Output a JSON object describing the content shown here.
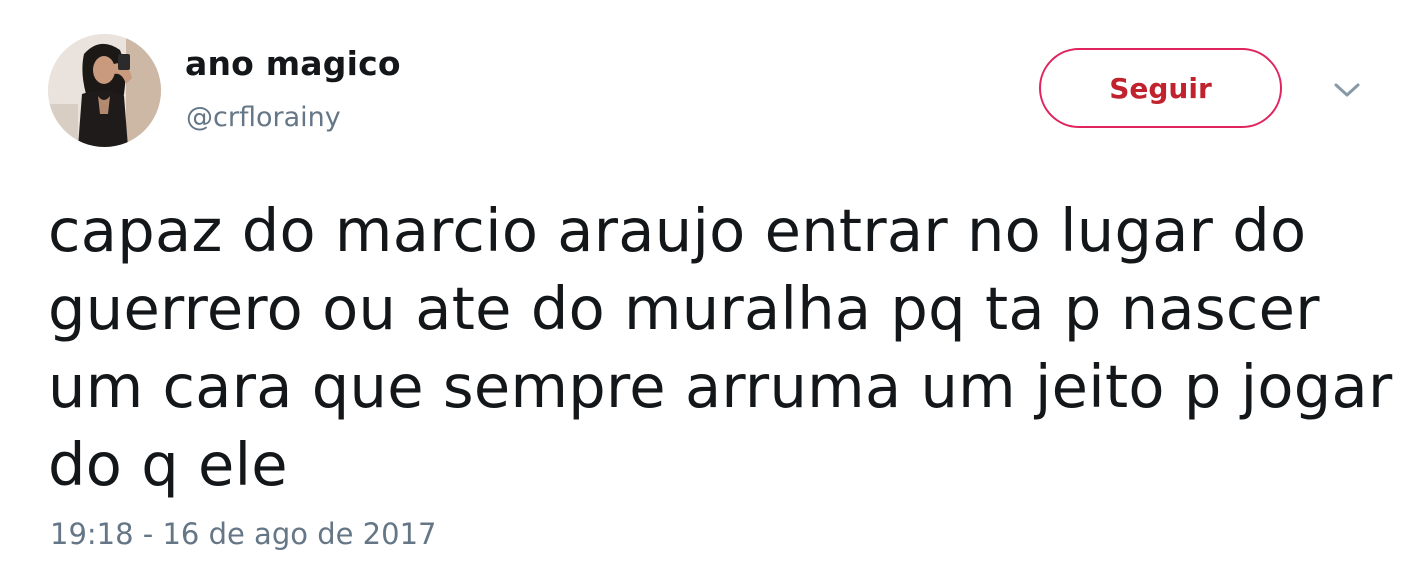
{
  "tweet": {
    "author": {
      "display_name": "ano magico",
      "handle": "@crflorainy"
    },
    "follow_button_label": "Seguir",
    "text_lines": [
      "capaz do marcio araujo entrar no lugar do",
      "guerrero ou ate do muralha pq ta p nascer",
      "um cara que sempre arruma um jeito p jogar",
      "do q ele"
    ],
    "timestamp": "19:18 - 16 de ago de 2017",
    "icons": {
      "avatar": "profile-photo",
      "caret": "chevron-down-icon"
    },
    "colors": {
      "follow_accent": "#e0245e",
      "primary_text": "#14171a",
      "secondary_text": "#657786"
    }
  }
}
